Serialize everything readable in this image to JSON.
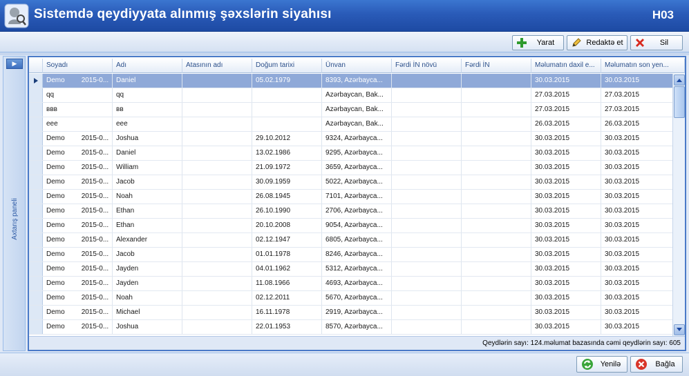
{
  "window": {
    "title": "Sistemdə qeydiyyata alınmış şəxslərin siyahısı",
    "code": "H03"
  },
  "toolbar": {
    "create_label": "Yarat",
    "edit_label": "Redaktə et",
    "delete_label": "Sil"
  },
  "sidepanel": {
    "label": "Axtarış paneli"
  },
  "grid": {
    "columns": [
      "Soyadı",
      "Adı",
      "Atasının adı",
      "Doğum tarixi",
      "Ünvan",
      "Fərdi İN növü",
      "Fərdi İN",
      "Məlumatın daxil e...",
      "Məlumatın son yen..."
    ],
    "rows": [
      {
        "soyadi": "Demo",
        "soyadi2": "2015-0...",
        "adi": "Daniel",
        "ata": "",
        "dogum": "05.02.1979",
        "unvan": "8393, Azərbayca...",
        "in_nov": "",
        "in": "",
        "daxil": "30.03.2015",
        "son": "30.03.2015",
        "selected": true
      },
      {
        "soyadi": "qq",
        "soyadi2": "",
        "adi": "qq",
        "ata": "",
        "dogum": "",
        "unvan": "Azərbaycan, Bak...",
        "in_nov": "",
        "in": "",
        "daxil": "27.03.2015",
        "son": "27.03.2015"
      },
      {
        "soyadi": "ввв",
        "soyadi2": "",
        "adi": "вв",
        "ata": "",
        "dogum": "",
        "unvan": "Azərbaycan, Bak...",
        "in_nov": "",
        "in": "",
        "daxil": "27.03.2015",
        "son": "27.03.2015"
      },
      {
        "soyadi": "eee",
        "soyadi2": "",
        "adi": "eee",
        "ata": "",
        "dogum": "",
        "unvan": "Azərbaycan, Bak...",
        "in_nov": "",
        "in": "",
        "daxil": "26.03.2015",
        "son": "26.03.2015"
      },
      {
        "soyadi": "Demo",
        "soyadi2": "2015-0...",
        "adi": "Joshua",
        "ata": "",
        "dogum": "29.10.2012",
        "unvan": "9324, Azərbayca...",
        "in_nov": "",
        "in": "",
        "daxil": "30.03.2015",
        "son": "30.03.2015"
      },
      {
        "soyadi": "Demo",
        "soyadi2": "2015-0...",
        "adi": "Daniel",
        "ata": "",
        "dogum": "13.02.1986",
        "unvan": "9295, Azərbayca...",
        "in_nov": "",
        "in": "",
        "daxil": "30.03.2015",
        "son": "30.03.2015"
      },
      {
        "soyadi": "Demo",
        "soyadi2": "2015-0...",
        "adi": "William",
        "ata": "",
        "dogum": "21.09.1972",
        "unvan": "3659, Azərbayca...",
        "in_nov": "",
        "in": "",
        "daxil": "30.03.2015",
        "son": "30.03.2015"
      },
      {
        "soyadi": "Demo",
        "soyadi2": "2015-0...",
        "adi": "Jacob",
        "ata": "",
        "dogum": "30.09.1959",
        "unvan": "5022, Azərbayca...",
        "in_nov": "",
        "in": "",
        "daxil": "30.03.2015",
        "son": "30.03.2015"
      },
      {
        "soyadi": "Demo",
        "soyadi2": "2015-0...",
        "adi": "Noah",
        "ata": "",
        "dogum": "26.08.1945",
        "unvan": "7101, Azərbayca...",
        "in_nov": "",
        "in": "",
        "daxil": "30.03.2015",
        "son": "30.03.2015"
      },
      {
        "soyadi": "Demo",
        "soyadi2": "2015-0...",
        "adi": "Ethan",
        "ata": "",
        "dogum": "26.10.1990",
        "unvan": "2706, Azərbayca...",
        "in_nov": "",
        "in": "",
        "daxil": "30.03.2015",
        "son": "30.03.2015"
      },
      {
        "soyadi": "Demo",
        "soyadi2": "2015-0...",
        "adi": "Ethan",
        "ata": "",
        "dogum": "20.10.2008",
        "unvan": "9054, Azərbayca...",
        "in_nov": "",
        "in": "",
        "daxil": "30.03.2015",
        "son": "30.03.2015"
      },
      {
        "soyadi": "Demo",
        "soyadi2": "2015-0...",
        "adi": "Alexander",
        "ata": "",
        "dogum": "02.12.1947",
        "unvan": "6805, Azərbayca...",
        "in_nov": "",
        "in": "",
        "daxil": "30.03.2015",
        "son": "30.03.2015"
      },
      {
        "soyadi": "Demo",
        "soyadi2": "2015-0...",
        "adi": "Jacob",
        "ata": "",
        "dogum": "01.01.1978",
        "unvan": "8246, Azərbayca...",
        "in_nov": "",
        "in": "",
        "daxil": "30.03.2015",
        "son": "30.03.2015"
      },
      {
        "soyadi": "Demo",
        "soyadi2": "2015-0...",
        "adi": "Jayden",
        "ata": "",
        "dogum": "04.01.1962",
        "unvan": "5312, Azərbayca...",
        "in_nov": "",
        "in": "",
        "daxil": "30.03.2015",
        "son": "30.03.2015"
      },
      {
        "soyadi": "Demo",
        "soyadi2": "2015-0...",
        "adi": "Jayden",
        "ata": "",
        "dogum": "11.08.1966",
        "unvan": "4693, Azərbayca...",
        "in_nov": "",
        "in": "",
        "daxil": "30.03.2015",
        "son": "30.03.2015"
      },
      {
        "soyadi": "Demo",
        "soyadi2": "2015-0...",
        "adi": "Noah",
        "ata": "",
        "dogum": "02.12.2011",
        "unvan": "5670, Azərbayca...",
        "in_nov": "",
        "in": "",
        "daxil": "30.03.2015",
        "son": "30.03.2015"
      },
      {
        "soyadi": "Demo",
        "soyadi2": "2015-0...",
        "adi": "Michael",
        "ata": "",
        "dogum": "16.11.1978",
        "unvan": "2919, Azərbayca...",
        "in_nov": "",
        "in": "",
        "daxil": "30.03.2015",
        "son": "30.03.2015"
      },
      {
        "soyadi": "Demo",
        "soyadi2": "2015-0...",
        "adi": "Joshua",
        "ata": "",
        "dogum": "22.01.1953",
        "unvan": "8570, Azərbayca...",
        "in_nov": "",
        "in": "",
        "daxil": "30.03.2015",
        "son": "30.03.2015"
      }
    ],
    "footer": "Qeydlərin sayı: 124.məlumat bazasında cəmi qeydlərin sayı: 605"
  },
  "bottombar": {
    "refresh_label": "Yenilə",
    "close_label": "Bağla"
  },
  "colors": {
    "titlebar": "#2a5bb8",
    "selected_row": "#8fa9d8",
    "grid_border": "#4a7ac8"
  }
}
